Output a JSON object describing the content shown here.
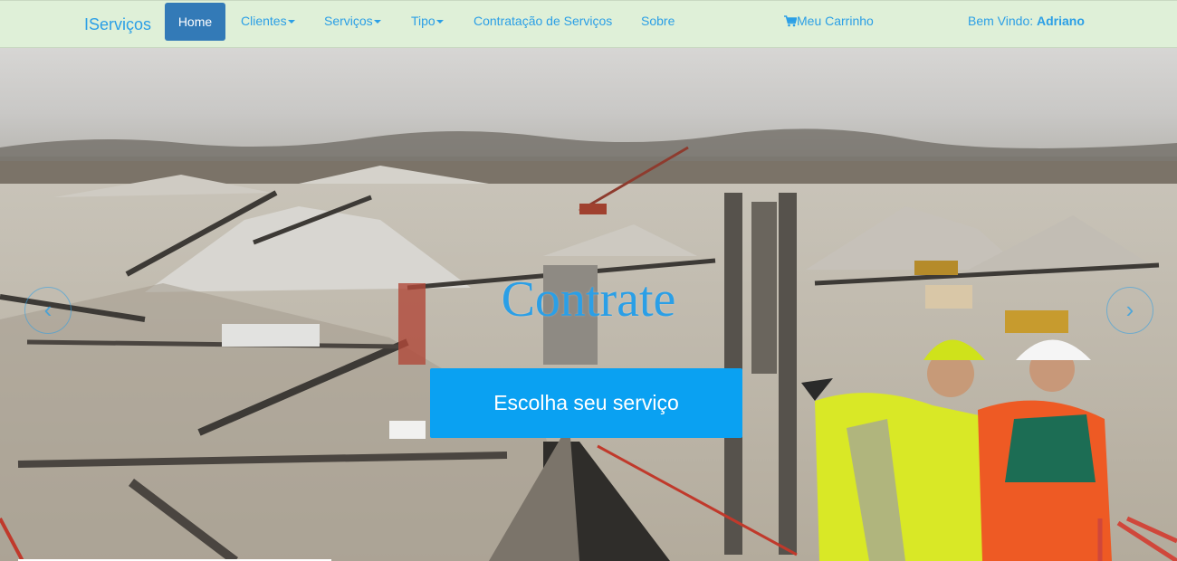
{
  "nav": {
    "brand": "IServiços",
    "home": "Home",
    "clientes": "Clientes",
    "servicos": "Serviços",
    "tipo": "Tipo",
    "contratacao": "Contratação de Serviços",
    "sobre": "Sobre",
    "cart": "Meu Carrinho",
    "welcome_prefix": "Bem Vindo:",
    "user": "Adriano"
  },
  "hero": {
    "title": "Contrate",
    "cta": "Escolha seu serviço",
    "prev": "‹",
    "next": "›"
  },
  "colors": {
    "accent": "#2b9fe6",
    "navbar_bg": "#dff0d8",
    "home_active": "#337ab7",
    "cta_bg": "#0aa1f2"
  },
  "icons": {
    "cart": "shopping-cart-icon",
    "prev": "chevron-left-icon",
    "next": "chevron-right-icon"
  }
}
